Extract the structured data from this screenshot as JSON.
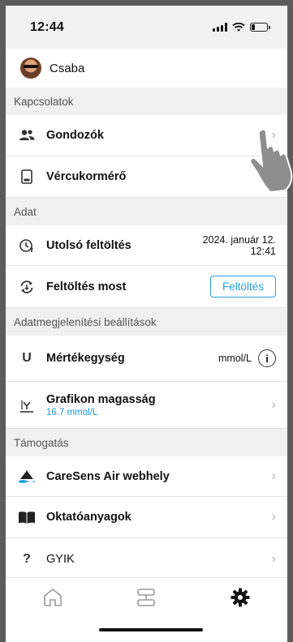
{
  "status": {
    "time": "12:44"
  },
  "user": {
    "name": "Csaba"
  },
  "sections": {
    "kapcsolatok": "Kapcsolatok",
    "adat": "Adat",
    "megjelenites": "Adatmegjelenítési beállítások",
    "tamogatas": "Támogatás"
  },
  "rows": {
    "gondozok": "Gondozók",
    "vercukormero": "Vércukormérő",
    "utolso_feltoltes": "Utolsó feltöltés",
    "utolso_feltoltes_date": "2024. január 12.",
    "utolso_feltoltes_time": "12:41",
    "feltoltes_most": "Feltöltés most",
    "feltoltes_button": "Feltöltés",
    "mertekegyseg": "Mértékegység",
    "mertekegyseg_value": "mmol/L",
    "grafikon": "Grafikon magasság",
    "grafikon_value": "16.7 mmol/L",
    "webhely": "CareSens Air webhely",
    "oktato": "Oktatóanyagok",
    "gyik": "GYIK"
  },
  "glyphs": {
    "chevron": "›",
    "info": "i",
    "unit_icon": "U",
    "faq_icon": "?"
  },
  "icons": [
    "people-icon",
    "device-icon",
    "upload-clock-icon",
    "sync-icon",
    "unit-icon",
    "chart-height-icon",
    "drop-icon",
    "book-icon",
    "question-icon",
    "home-icon",
    "list-icon",
    "gear-icon"
  ],
  "colors": {
    "accent": "#2aa2e0",
    "section_bg": "#f0f0f0",
    "chevron": "#b0b0b0"
  }
}
